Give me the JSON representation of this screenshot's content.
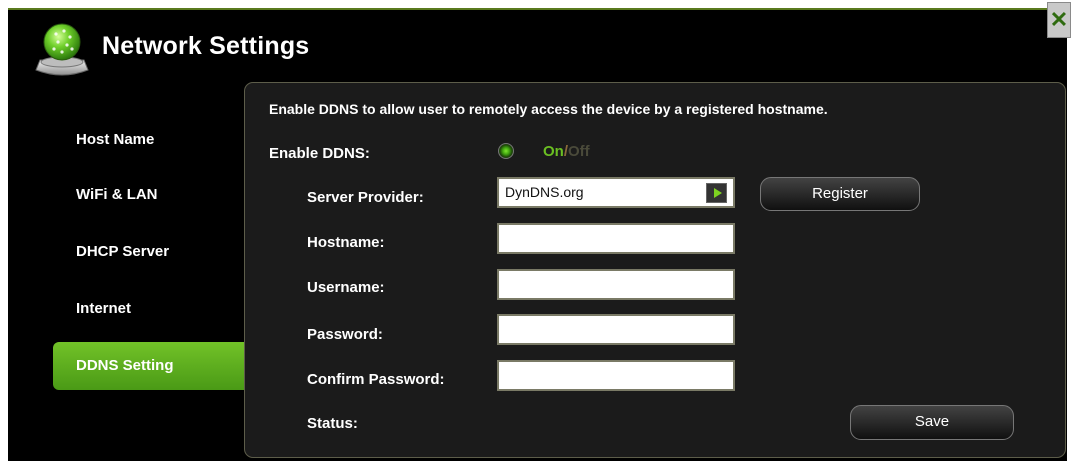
{
  "title": "Network Settings",
  "close_label": "✕",
  "sidebar": {
    "items": [
      {
        "label": "Host Name"
      },
      {
        "label": "WiFi & LAN"
      },
      {
        "label": "DHCP Server"
      },
      {
        "label": "Internet"
      },
      {
        "label": "DDNS Setting",
        "active": true
      }
    ]
  },
  "ddns": {
    "description": "Enable DDNS to allow user to remotely access the device by a registered hostname.",
    "enable_label": "Enable DDNS:",
    "toggle_on": "On",
    "toggle_sep": "/",
    "toggle_off": "Off",
    "server_provider_label": "Server Provider:",
    "server_provider_value": "DynDNS.org",
    "register_label": "Register",
    "hostname_label": "Hostname:",
    "hostname_value": "",
    "username_label": "Username:",
    "username_value": "",
    "password_label": "Password:",
    "password_value": "",
    "confirm_password_label": "Confirm Password:",
    "confirm_password_value": "",
    "status_label": "Status:",
    "save_label": "Save"
  },
  "colors": {
    "accent_green": "#6bbf22",
    "active_nav": "#5aa81c",
    "background": "#000000",
    "panel": "#1b1b1b"
  },
  "icons": {
    "title": "network-globe-icon",
    "close": "close-icon",
    "dropdown": "play-arrow-icon",
    "radio": "radio-on-icon"
  }
}
